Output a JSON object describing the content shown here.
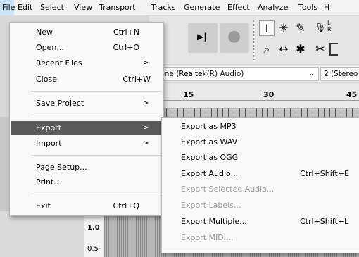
{
  "menubar": {
    "items": [
      "File",
      "Edit",
      "Select",
      "View",
      "Transport",
      "Tracks",
      "Generate",
      "Effect",
      "Analyze",
      "Tools",
      "H"
    ]
  },
  "toolbar": {
    "skip_end_icon": "▶|",
    "record_icon": "●",
    "tool_icons": [
      "I",
      "✳",
      "✎",
      "🎙",
      "⌕",
      "↔",
      "✱",
      "✂"
    ],
    "side_letters": [
      "L",
      "R"
    ]
  },
  "device": {
    "recording_device": "phone (Realtek(R) Audio)",
    "channels": "2 (Stereo"
  },
  "ruler": {
    "labels": [
      "15",
      "30",
      "45"
    ]
  },
  "track": {
    "scale_values": [
      "1.0",
      "0.5-"
    ]
  },
  "file_menu": {
    "items": [
      {
        "label": "New",
        "shortcut": "Ctrl+N"
      },
      {
        "label": "Open...",
        "shortcut": "Ctrl+O"
      },
      {
        "label": "Recent Files",
        "arrow": ">"
      },
      {
        "label": "Close",
        "shortcut": "Ctrl+W"
      },
      {
        "label": "Save Project",
        "arrow": ">"
      },
      {
        "label": "Export",
        "arrow": ">"
      },
      {
        "label": "Import",
        "arrow": ">"
      },
      {
        "label": "Page Setup..."
      },
      {
        "label": "Print..."
      },
      {
        "label": "Exit",
        "shortcut": "Ctrl+Q"
      }
    ]
  },
  "export_menu": {
    "items": [
      {
        "label": "Export as MP3"
      },
      {
        "label": "Export as WAV"
      },
      {
        "label": "Export as OGG"
      },
      {
        "label": "Export Audio...",
        "shortcut": "Ctrl+Shift+E"
      },
      {
        "label": "Export Selected Audio..."
      },
      {
        "label": "Export Labels..."
      },
      {
        "label": "Export Multiple...",
        "shortcut": "Ctrl+Shift+L"
      },
      {
        "label": "Export MIDI..."
      }
    ]
  }
}
